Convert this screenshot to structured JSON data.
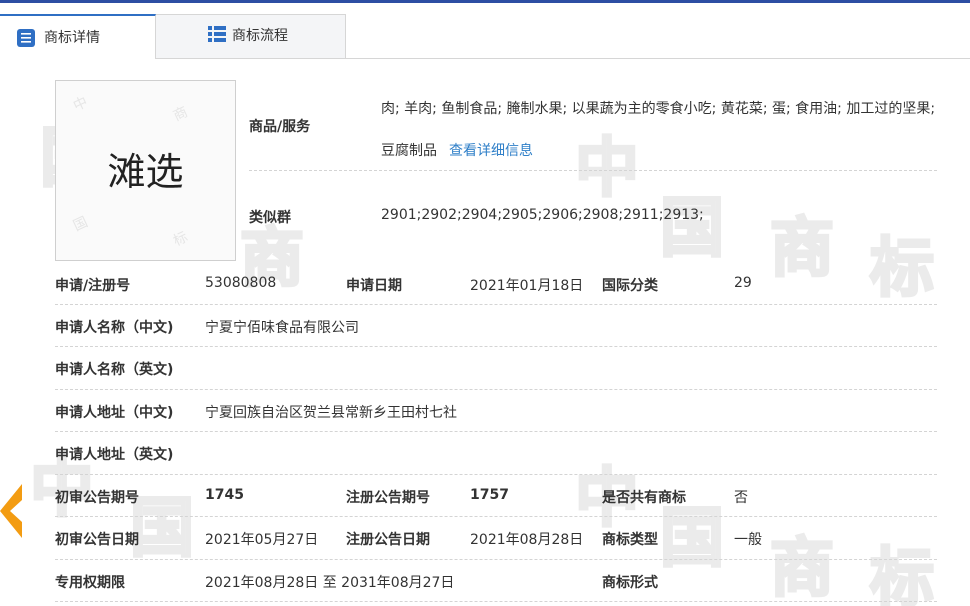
{
  "tabs": [
    {
      "label": "商标详情",
      "active": true,
      "icon": "document-list-icon"
    },
    {
      "label": "商标流程",
      "active": false,
      "icon": "grid-list-icon"
    }
  ],
  "watermark": {
    "glyphs": [
      "中",
      "国",
      "商",
      "标"
    ]
  },
  "logo": {
    "text": "滩选"
  },
  "goods": {
    "label": "商品/服务",
    "value": "肉; 羊肉; 鱼制食品; 腌制水果; 以果蔬为主的零食小吃; 黄花菜; 蛋; 食用油; 加工过的坚果; 豆腐制品",
    "link": "查看详细信息"
  },
  "similar_group": {
    "label": "类似群",
    "value": "2901;2902;2904;2905;2906;2908;2911;2913;"
  },
  "fields": {
    "reg_no_label": "申请/注册号",
    "reg_no": "53080808",
    "apply_date_label": "申请日期",
    "apply_date": "2021年01月18日",
    "intl_class_label": "国际分类",
    "intl_class": "29",
    "applicant_cn_label": "申请人名称（中文)",
    "applicant_cn": "宁夏宁佰味食品有限公司",
    "applicant_en_label": "申请人名称（英文)",
    "applicant_en": "",
    "address_cn_label": "申请人地址（中文)",
    "address_cn": "宁夏回族自治区贺兰县常新乡王田村七社",
    "address_en_label": "申请人地址（英文)",
    "address_en": "",
    "prelim_no_label": "初审公告期号",
    "prelim_no": "1745",
    "reg_pub_no_label": "注册公告期号",
    "reg_pub_no": "1757",
    "shared_label": "是否共有商标",
    "shared": "否",
    "prelim_date_label": "初审公告日期",
    "prelim_date": "2021年05月27日",
    "reg_pub_date_label": "注册公告日期",
    "reg_pub_date": "2021年08月28日",
    "tm_type_label": "商标类型",
    "tm_type": "一般",
    "exclusive_label": "专用权期限",
    "exclusive": "2021年08月28日 至 2031年08月27日",
    "tm_form_label": "商标形式",
    "tm_form": ""
  },
  "colors": {
    "accent": "#2f6fc4",
    "link": "#2f7fc8",
    "arrow": "#f39c12",
    "top_bar": "#2d4ea3"
  }
}
